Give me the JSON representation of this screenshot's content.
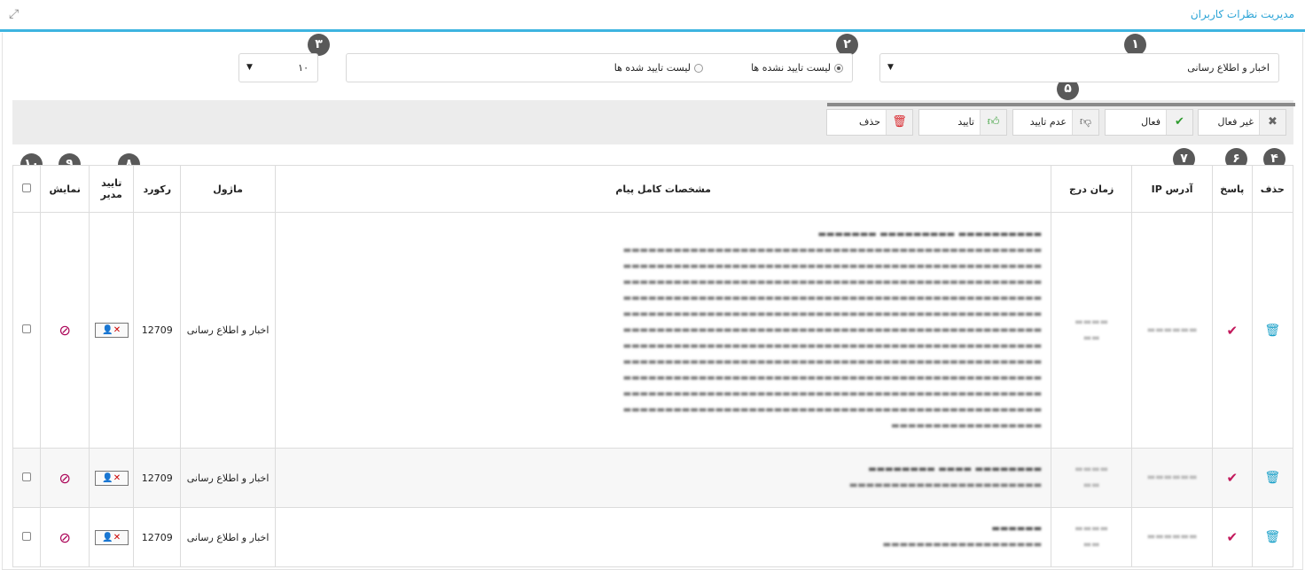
{
  "header": {
    "title": "مدیریت نظرات کاربران",
    "expand_icon": "expand-icon"
  },
  "badges": [
    "۱",
    "۲",
    "۳",
    "۴",
    "۵",
    "۶",
    "۷",
    "۸",
    "۹",
    "۱۰"
  ],
  "filters": {
    "module_select": "اخبار و اطلاع رسانی",
    "radio_unapproved": "لیست تایید نشده ها",
    "radio_approved": "لیست تایید شده ها",
    "page_size": "۱۰"
  },
  "toolbar": {
    "deactivate": "غیر فعال",
    "activate": "فعال",
    "reject": "عدم تایید",
    "approve": "تایید",
    "delete": "حذف"
  },
  "table": {
    "headers": {
      "show": "نمایش",
      "admin_approve": "تایید مدیر",
      "record": "رکورد",
      "module": "ماژول",
      "message": "مشخصات کامل پیام",
      "date": "زمان درج",
      "ip": "آدرس IP",
      "reply": "پاسخ",
      "delete": "حذف"
    },
    "rows": [
      {
        "record": "12709",
        "module": "اخبار و اطلاع رسانی"
      },
      {
        "record": "12709",
        "module": "اخبار و اطلاع رسانی"
      },
      {
        "record": "12709",
        "module": "اخبار و اطلاع رسانی"
      }
    ]
  },
  "colors": {
    "accent": "#3db4e0",
    "badge": "#595959"
  }
}
